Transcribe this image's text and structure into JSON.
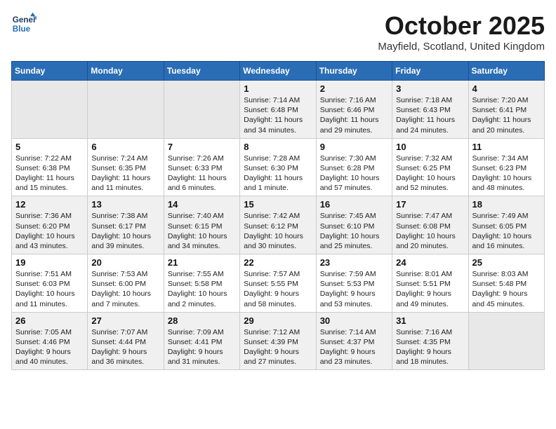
{
  "logo": {
    "line1": "General",
    "line2": "Blue"
  },
  "title": "October 2025",
  "subtitle": "Mayfield, Scotland, United Kingdom",
  "days_of_week": [
    "Sunday",
    "Monday",
    "Tuesday",
    "Wednesday",
    "Thursday",
    "Friday",
    "Saturday"
  ],
  "weeks": [
    [
      {
        "day": "",
        "info": ""
      },
      {
        "day": "",
        "info": ""
      },
      {
        "day": "",
        "info": ""
      },
      {
        "day": "1",
        "info": "Sunrise: 7:14 AM\nSunset: 6:48 PM\nDaylight: 11 hours\nand 34 minutes."
      },
      {
        "day": "2",
        "info": "Sunrise: 7:16 AM\nSunset: 6:46 PM\nDaylight: 11 hours\nand 29 minutes."
      },
      {
        "day": "3",
        "info": "Sunrise: 7:18 AM\nSunset: 6:43 PM\nDaylight: 11 hours\nand 24 minutes."
      },
      {
        "day": "4",
        "info": "Sunrise: 7:20 AM\nSunset: 6:41 PM\nDaylight: 11 hours\nand 20 minutes."
      }
    ],
    [
      {
        "day": "5",
        "info": "Sunrise: 7:22 AM\nSunset: 6:38 PM\nDaylight: 11 hours\nand 15 minutes."
      },
      {
        "day": "6",
        "info": "Sunrise: 7:24 AM\nSunset: 6:35 PM\nDaylight: 11 hours\nand 11 minutes."
      },
      {
        "day": "7",
        "info": "Sunrise: 7:26 AM\nSunset: 6:33 PM\nDaylight: 11 hours\nand 6 minutes."
      },
      {
        "day": "8",
        "info": "Sunrise: 7:28 AM\nSunset: 6:30 PM\nDaylight: 11 hours\nand 1 minute."
      },
      {
        "day": "9",
        "info": "Sunrise: 7:30 AM\nSunset: 6:28 PM\nDaylight: 10 hours\nand 57 minutes."
      },
      {
        "day": "10",
        "info": "Sunrise: 7:32 AM\nSunset: 6:25 PM\nDaylight: 10 hours\nand 52 minutes."
      },
      {
        "day": "11",
        "info": "Sunrise: 7:34 AM\nSunset: 6:23 PM\nDaylight: 10 hours\nand 48 minutes."
      }
    ],
    [
      {
        "day": "12",
        "info": "Sunrise: 7:36 AM\nSunset: 6:20 PM\nDaylight: 10 hours\nand 43 minutes."
      },
      {
        "day": "13",
        "info": "Sunrise: 7:38 AM\nSunset: 6:17 PM\nDaylight: 10 hours\nand 39 minutes."
      },
      {
        "day": "14",
        "info": "Sunrise: 7:40 AM\nSunset: 6:15 PM\nDaylight: 10 hours\nand 34 minutes."
      },
      {
        "day": "15",
        "info": "Sunrise: 7:42 AM\nSunset: 6:12 PM\nDaylight: 10 hours\nand 30 minutes."
      },
      {
        "day": "16",
        "info": "Sunrise: 7:45 AM\nSunset: 6:10 PM\nDaylight: 10 hours\nand 25 minutes."
      },
      {
        "day": "17",
        "info": "Sunrise: 7:47 AM\nSunset: 6:08 PM\nDaylight: 10 hours\nand 20 minutes."
      },
      {
        "day": "18",
        "info": "Sunrise: 7:49 AM\nSunset: 6:05 PM\nDaylight: 10 hours\nand 16 minutes."
      }
    ],
    [
      {
        "day": "19",
        "info": "Sunrise: 7:51 AM\nSunset: 6:03 PM\nDaylight: 10 hours\nand 11 minutes."
      },
      {
        "day": "20",
        "info": "Sunrise: 7:53 AM\nSunset: 6:00 PM\nDaylight: 10 hours\nand 7 minutes."
      },
      {
        "day": "21",
        "info": "Sunrise: 7:55 AM\nSunset: 5:58 PM\nDaylight: 10 hours\nand 2 minutes."
      },
      {
        "day": "22",
        "info": "Sunrise: 7:57 AM\nSunset: 5:55 PM\nDaylight: 9 hours\nand 58 minutes."
      },
      {
        "day": "23",
        "info": "Sunrise: 7:59 AM\nSunset: 5:53 PM\nDaylight: 9 hours\nand 53 minutes."
      },
      {
        "day": "24",
        "info": "Sunrise: 8:01 AM\nSunset: 5:51 PM\nDaylight: 9 hours\nand 49 minutes."
      },
      {
        "day": "25",
        "info": "Sunrise: 8:03 AM\nSunset: 5:48 PM\nDaylight: 9 hours\nand 45 minutes."
      }
    ],
    [
      {
        "day": "26",
        "info": "Sunrise: 7:05 AM\nSunset: 4:46 PM\nDaylight: 9 hours\nand 40 minutes."
      },
      {
        "day": "27",
        "info": "Sunrise: 7:07 AM\nSunset: 4:44 PM\nDaylight: 9 hours\nand 36 minutes."
      },
      {
        "day": "28",
        "info": "Sunrise: 7:09 AM\nSunset: 4:41 PM\nDaylight: 9 hours\nand 31 minutes."
      },
      {
        "day": "29",
        "info": "Sunrise: 7:12 AM\nSunset: 4:39 PM\nDaylight: 9 hours\nand 27 minutes."
      },
      {
        "day": "30",
        "info": "Sunrise: 7:14 AM\nSunset: 4:37 PM\nDaylight: 9 hours\nand 23 minutes."
      },
      {
        "day": "31",
        "info": "Sunrise: 7:16 AM\nSunset: 4:35 PM\nDaylight: 9 hours\nand 18 minutes."
      },
      {
        "day": "",
        "info": ""
      }
    ]
  ]
}
